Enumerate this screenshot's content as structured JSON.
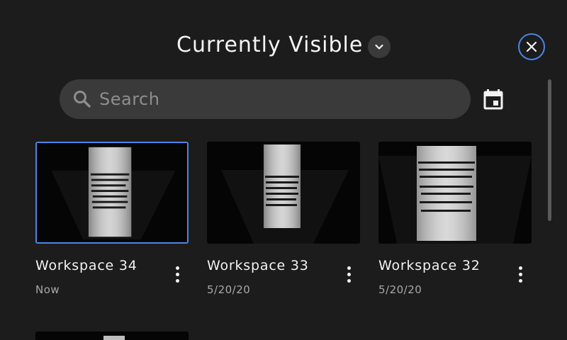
{
  "header": {
    "title": "Currently Visible"
  },
  "search": {
    "placeholder": "Search",
    "value": ""
  },
  "colors": {
    "accent": "#4a86e8",
    "background": "#1c1c1c",
    "surface": "#3a3a3a"
  },
  "icons": {
    "dropdown": "chevron-down-icon",
    "close": "close-icon",
    "search": "search-icon",
    "calendar": "calendar-icon",
    "more": "more-vertical-icon"
  },
  "workspaces": [
    {
      "name": "Workspace 34",
      "date": "Now",
      "selected": true
    },
    {
      "name": "Workspace 33",
      "date": "5/20/20",
      "selected": false
    },
    {
      "name": "Workspace 32",
      "date": "5/20/20",
      "selected": false
    }
  ]
}
